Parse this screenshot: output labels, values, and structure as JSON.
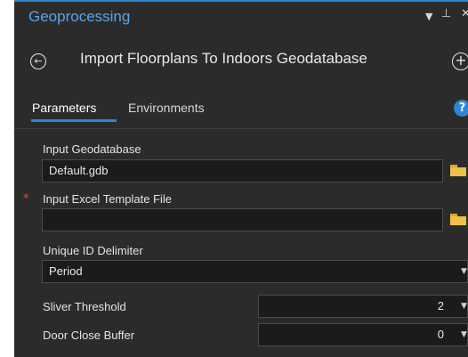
{
  "pane": {
    "title": "Geoprocessing",
    "accent_color": "#2f84d3",
    "title_color": "#5aa5e8",
    "background_color": "#2b2b2b"
  },
  "titlebar": {
    "menu_icon": "chevron-down-icon",
    "pin_icon": "pin-icon",
    "close_icon": "close-icon"
  },
  "tool": {
    "back_icon": "back-arrow-icon",
    "name": "Import Floorplans To Indoors Geodatabase",
    "add_icon": "add-icon"
  },
  "tabs": [
    {
      "label": "Parameters",
      "active": true
    },
    {
      "label": "Environments",
      "active": false
    }
  ],
  "help_icon": "help-icon",
  "parameters": {
    "input_geodatabase": {
      "label": "Input Geodatabase",
      "value": "Default.gdb",
      "browse_icon": "folder-icon"
    },
    "input_excel": {
      "label": "Input Excel Template File",
      "required_marker": "*",
      "value": "",
      "browse_icon": "folder-icon"
    },
    "unique_id": {
      "label": "Unique ID Delimiter",
      "value": "Period"
    },
    "sliver_threshold": {
      "label": "Sliver Threshold",
      "value": "2"
    },
    "door_close_buffer": {
      "label": "Door Close Buffer",
      "value": "0"
    }
  }
}
